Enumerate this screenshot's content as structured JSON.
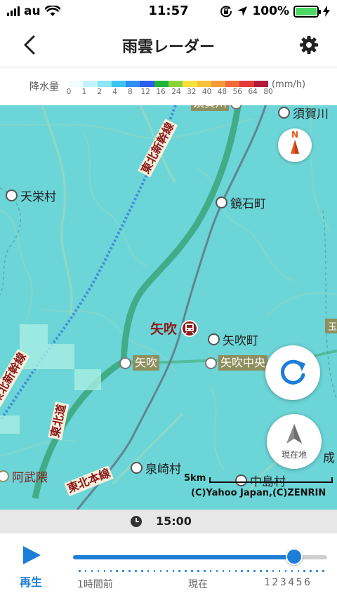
{
  "status_bar": {
    "carrier": "au",
    "time": "11:57",
    "battery": "100%",
    "battery_level": 1.0
  },
  "nav": {
    "title": "雨雲レーダー",
    "back_icon": "chevron-left-icon",
    "settings_icon": "gear-icon"
  },
  "legend": {
    "label": "降水量",
    "unit": "(mm/h)",
    "ticks": [
      "0",
      "1",
      "2",
      "4",
      "8",
      "12",
      "16",
      "24",
      "32",
      "40",
      "48",
      "56",
      "64",
      "80"
    ],
    "colors": [
      "#f2fbfe",
      "#c2f3fb",
      "#8be6f5",
      "#3fc4f2",
      "#2f8ff0",
      "#2b5ef0",
      "#22b33a",
      "#8bd33a",
      "#f4e23a",
      "#f7c33a",
      "#f59a3a",
      "#f26a3a",
      "#e53a3a",
      "#b31a3a"
    ]
  },
  "map": {
    "rail_lines": [
      "東北新幹線",
      "東北新幹線",
      "東北本線",
      "東北道"
    ],
    "places": {
      "tenei": "天栄村",
      "kagamiishi": "鏡石町",
      "yabuki_town": "矢吹町",
      "izumizaki": "泉崎村",
      "nakajima": "中島村",
      "sukagawa": "須賀川",
      "abukuma": "阿武隈",
      "naru": "成"
    },
    "stations": {
      "yabuki_major": "矢吹",
      "yabuki": "矢吹",
      "yabuki_chuo": "矢吹中央",
      "top_partial": "須賀川",
      "tama": "玉"
    },
    "compass_label": "N",
    "locate_label": "現在地",
    "scale_label": "5km",
    "copyright": "(C)Yahoo Japan,(C)ZENRIN"
  },
  "time_bar": {
    "time": "15:00"
  },
  "playback": {
    "play_label": "再生",
    "position": 0.87,
    "labels": {
      "one_hour_ago": "1時間前",
      "now": "現在",
      "future": "123456"
    }
  }
}
